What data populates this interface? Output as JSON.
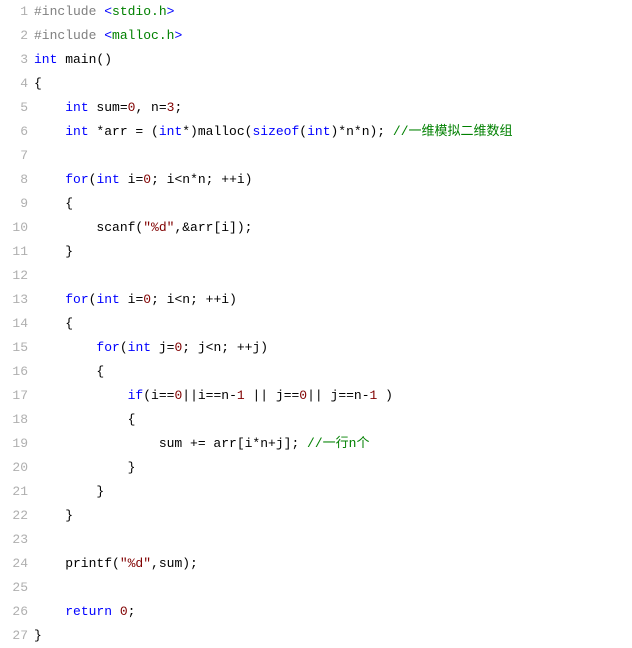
{
  "lines": [
    {
      "n": "1",
      "tokens": [
        {
          "t": "#include ",
          "c": "pp"
        },
        {
          "t": "<",
          "c": "inc"
        },
        {
          "t": "stdio.h",
          "c": "hdr"
        },
        {
          "t": ">",
          "c": "inc"
        }
      ]
    },
    {
      "n": "2",
      "tokens": [
        {
          "t": "#include ",
          "c": "pp"
        },
        {
          "t": "<",
          "c": "inc"
        },
        {
          "t": "malloc.h",
          "c": "hdr"
        },
        {
          "t": ">",
          "c": "inc"
        }
      ]
    },
    {
      "n": "3",
      "tokens": [
        {
          "t": "int",
          "c": "kw"
        },
        {
          "t": " main()",
          "c": "id"
        }
      ]
    },
    {
      "n": "4",
      "tokens": [
        {
          "t": "{",
          "c": "id"
        }
      ]
    },
    {
      "n": "5",
      "tokens": [
        {
          "t": "    ",
          "c": "id"
        },
        {
          "t": "int",
          "c": "kw"
        },
        {
          "t": " sum=",
          "c": "id"
        },
        {
          "t": "0",
          "c": "num"
        },
        {
          "t": ", n=",
          "c": "id"
        },
        {
          "t": "3",
          "c": "num"
        },
        {
          "t": ";",
          "c": "id"
        }
      ]
    },
    {
      "n": "6",
      "tokens": [
        {
          "t": "    ",
          "c": "id"
        },
        {
          "t": "int",
          "c": "kw"
        },
        {
          "t": " *arr = (",
          "c": "id"
        },
        {
          "t": "int",
          "c": "kw"
        },
        {
          "t": "*)malloc(",
          "c": "id"
        },
        {
          "t": "sizeof",
          "c": "kw"
        },
        {
          "t": "(",
          "c": "id"
        },
        {
          "t": "int",
          "c": "kw"
        },
        {
          "t": ")*n*n); ",
          "c": "id"
        },
        {
          "t": "//一维模拟二维数组",
          "c": "cmt"
        }
      ]
    },
    {
      "n": "7",
      "tokens": []
    },
    {
      "n": "8",
      "tokens": [
        {
          "t": "    ",
          "c": "id"
        },
        {
          "t": "for",
          "c": "kw"
        },
        {
          "t": "(",
          "c": "id"
        },
        {
          "t": "int",
          "c": "kw"
        },
        {
          "t": " i=",
          "c": "id"
        },
        {
          "t": "0",
          "c": "num"
        },
        {
          "t": "; i<n*n; ++i)",
          "c": "id"
        }
      ]
    },
    {
      "n": "9",
      "tokens": [
        {
          "t": "    {",
          "c": "id"
        }
      ]
    },
    {
      "n": "10",
      "tokens": [
        {
          "t": "        scanf(",
          "c": "id"
        },
        {
          "t": "\"%d\"",
          "c": "str"
        },
        {
          "t": ",&arr[i]);",
          "c": "id"
        }
      ]
    },
    {
      "n": "11",
      "tokens": [
        {
          "t": "    }",
          "c": "id"
        }
      ]
    },
    {
      "n": "12",
      "tokens": []
    },
    {
      "n": "13",
      "tokens": [
        {
          "t": "    ",
          "c": "id"
        },
        {
          "t": "for",
          "c": "kw"
        },
        {
          "t": "(",
          "c": "id"
        },
        {
          "t": "int",
          "c": "kw"
        },
        {
          "t": " i=",
          "c": "id"
        },
        {
          "t": "0",
          "c": "num"
        },
        {
          "t": "; i<n; ++i)",
          "c": "id"
        }
      ]
    },
    {
      "n": "14",
      "tokens": [
        {
          "t": "    {",
          "c": "id"
        }
      ]
    },
    {
      "n": "15",
      "tokens": [
        {
          "t": "        ",
          "c": "id"
        },
        {
          "t": "for",
          "c": "kw"
        },
        {
          "t": "(",
          "c": "id"
        },
        {
          "t": "int",
          "c": "kw"
        },
        {
          "t": " j=",
          "c": "id"
        },
        {
          "t": "0",
          "c": "num"
        },
        {
          "t": "; j<n; ++j)",
          "c": "id"
        }
      ]
    },
    {
      "n": "16",
      "tokens": [
        {
          "t": "        {",
          "c": "id"
        }
      ]
    },
    {
      "n": "17",
      "tokens": [
        {
          "t": "            ",
          "c": "id"
        },
        {
          "t": "if",
          "c": "kw"
        },
        {
          "t": "(i==",
          "c": "id"
        },
        {
          "t": "0",
          "c": "num"
        },
        {
          "t": "||i==n-",
          "c": "id"
        },
        {
          "t": "1",
          "c": "num"
        },
        {
          "t": " || j==",
          "c": "id"
        },
        {
          "t": "0",
          "c": "num"
        },
        {
          "t": "|| j==n-",
          "c": "id"
        },
        {
          "t": "1",
          "c": "num"
        },
        {
          "t": " )",
          "c": "id"
        }
      ]
    },
    {
      "n": "18",
      "tokens": [
        {
          "t": "            {",
          "c": "id"
        }
      ]
    },
    {
      "n": "19",
      "tokens": [
        {
          "t": "                sum += arr[i*n+j]; ",
          "c": "id"
        },
        {
          "t": "//一行n个",
          "c": "cmt"
        }
      ]
    },
    {
      "n": "20",
      "tokens": [
        {
          "t": "            }",
          "c": "id"
        }
      ]
    },
    {
      "n": "21",
      "tokens": [
        {
          "t": "        }",
          "c": "id"
        }
      ]
    },
    {
      "n": "22",
      "tokens": [
        {
          "t": "    }",
          "c": "id"
        }
      ]
    },
    {
      "n": "23",
      "tokens": []
    },
    {
      "n": "24",
      "tokens": [
        {
          "t": "    printf(",
          "c": "id"
        },
        {
          "t": "\"%d\"",
          "c": "str"
        },
        {
          "t": ",sum);",
          "c": "id"
        }
      ]
    },
    {
      "n": "25",
      "tokens": []
    },
    {
      "n": "26",
      "tokens": [
        {
          "t": "    ",
          "c": "id"
        },
        {
          "t": "return",
          "c": "kw"
        },
        {
          "t": " ",
          "c": "id"
        },
        {
          "t": "0",
          "c": "num"
        },
        {
          "t": ";",
          "c": "id"
        }
      ]
    },
    {
      "n": "27",
      "tokens": [
        {
          "t": "}",
          "c": "id"
        }
      ]
    }
  ]
}
